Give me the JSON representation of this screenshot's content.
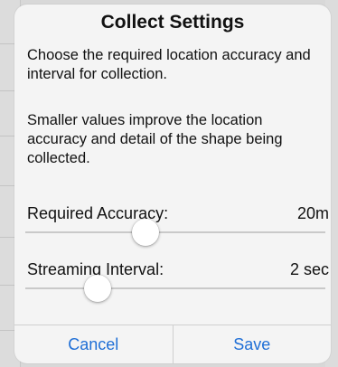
{
  "dialog": {
    "title": "Collect Settings",
    "description_1": "Choose the required location accuracy and interval for collection.",
    "description_2": "Smaller values improve the location accuracy and detail of the shape being collected.",
    "settings": [
      {
        "label": "Required Accuracy:",
        "value": "20m",
        "slider_fraction": 0.4
      },
      {
        "label": "Streaming Interval:",
        "value": "2 sec",
        "slider_fraction": 0.24
      }
    ],
    "cancel_label": "Cancel",
    "save_label": "Save"
  },
  "colors": {
    "button_text": "#1f6fd6",
    "dialog_background": "#f4f4f4",
    "track": "#c9c9c9"
  }
}
